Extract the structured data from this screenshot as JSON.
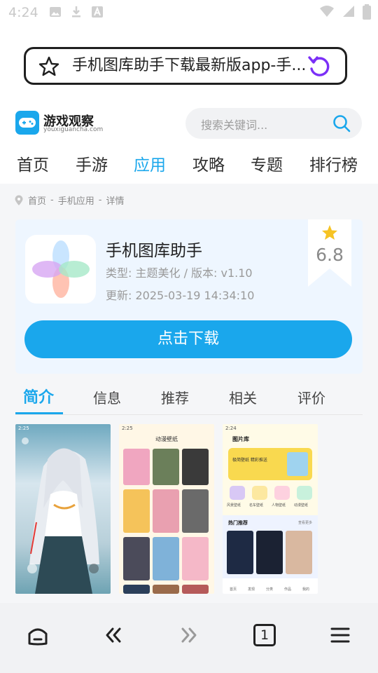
{
  "status_bar": {
    "time": "4:24",
    "left_icons": [
      "image-icon",
      "download-icon",
      "a-icon"
    ],
    "right_icons": [
      "wifi-icon",
      "signal-icon",
      "battery-icon"
    ]
  },
  "browser": {
    "url_title": "手机图库助手下载最新版app-手...",
    "tab_count": "1"
  },
  "site": {
    "logo_name": "游戏观察",
    "logo_domain": "youxiguancha.com",
    "search_placeholder": "搜索关键词...",
    "nav": [
      "首页",
      "手游",
      "应用",
      "攻略",
      "专题",
      "排行榜"
    ],
    "nav_active": "应用"
  },
  "breadcrumb": [
    "首页",
    "-",
    "手机应用",
    "-",
    "详情"
  ],
  "app": {
    "name": "手机图库助手",
    "meta": "类型: 主题美化 / 版本: v1.10",
    "update": "更新:  2025-03-19 14:34:10",
    "rating": "6.8",
    "download_label": "点击下载"
  },
  "tabs": [
    "简介",
    "信息",
    "推荐",
    "相关",
    "评价"
  ],
  "screenshots": {
    "shot1_time": "2:25",
    "shot2_time": "2:25",
    "shot2_title": "动漫壁纸",
    "shot3_time": "2:24",
    "shot3_title": "图片库",
    "shot3_banner": "极简壁纸 精彩推送",
    "shot3_categories": [
      "风景壁纸",
      "名车壁纸",
      "人物壁纸",
      "动漫壁纸"
    ],
    "shot3_hot": "热门推荐",
    "shot3_more": "查看更多",
    "shot3_bottom_nav": [
      "首页",
      "发现",
      "分类",
      "作品",
      "我的"
    ]
  },
  "colors": {
    "accent": "#1aa7ec",
    "star": "#f6c324"
  }
}
